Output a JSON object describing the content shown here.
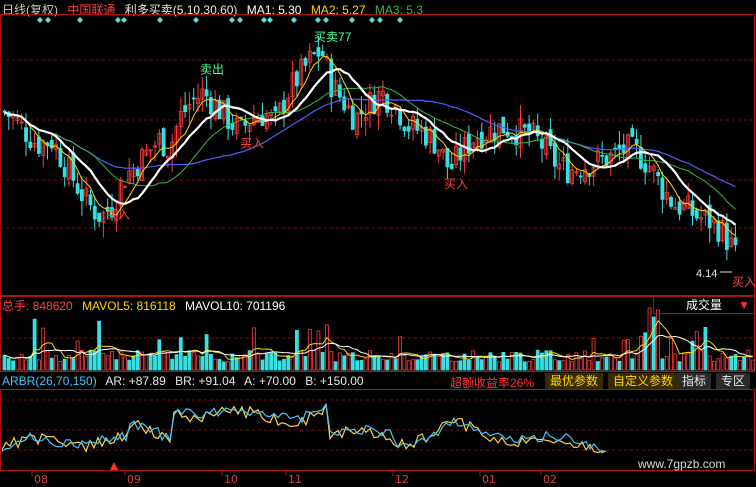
{
  "colors": {
    "bg": "#000000",
    "up": "#ff3b3b",
    "down": "#36e0e0",
    "ma1": "#ffffff",
    "ma2": "#ffd700",
    "ma3": "#3bb54a",
    "ma4": "#5060ff",
    "grid": "#7a1010",
    "border": "#b01010",
    "ar": "#40c8ff",
    "br": "#ffd24a",
    "signal": "#4dff9a"
  },
  "header": {
    "period": "日线(复权)",
    "stock_name": "中国联通",
    "indicator": "利多买卖(5,10,30,60)",
    "ma1_label": "MA1: 5.30",
    "ma2_label": "MA2: 5.27",
    "ma3_label": "MA3: 5.3"
  },
  "price_panel": {
    "signals": {
      "buy": "买入",
      "sell": "卖出",
      "buy_sell": "买卖"
    },
    "high_label": "77",
    "low_label": "4.14"
  },
  "volume_panel": {
    "total_label": "总手: 848620",
    "mavol5_label": "MAVOL5: 816118",
    "mavol10_label": "MAVOL10: 701196",
    "selector": "成交量"
  },
  "arbr_panel": {
    "name": "ARBR(26,70,150)",
    "ar_label": "AR: +87.89",
    "br_label": "BR: +91.04",
    "a_label": "A: +70.00",
    "b_label": "B: +150.00",
    "excess_return": "超额收益率26%",
    "btn_best": "最优参数",
    "btn_custom": "自定义参数",
    "btn_indicator": "指标",
    "btn_zone": "专区"
  },
  "x_axis": {
    "ticks": [
      "08",
      "09",
      "10",
      "11",
      "12",
      "01",
      "02"
    ]
  },
  "watermark": "www.7gpzb.com",
  "chart_data": [
    {
      "type": "candlestick",
      "title": "日线(复权) 中国联通",
      "series": [
        {
          "name": "MA1",
          "color": "#ffffff"
        },
        {
          "name": "MA2",
          "color": "#ffd700"
        },
        {
          "name": "MA3",
          "color": "#3bb54a"
        }
      ],
      "ma_values": {
        "MA1": 5.3,
        "MA2": 5.27,
        "MA3": 5.3
      },
      "points": [
        {
          "x": 0,
          "p": 5.95
        },
        {
          "x": 12,
          "p": 5.85
        },
        {
          "x": 24,
          "p": 5.7
        },
        {
          "x": 36,
          "p": 5.55
        },
        {
          "x": 50,
          "p": 5.6
        },
        {
          "x": 62,
          "p": 5.35
        },
        {
          "x": 74,
          "p": 5.1
        },
        {
          "x": 86,
          "p": 4.85
        },
        {
          "x": 100,
          "p": 4.7
        },
        {
          "x": 112,
          "p": 4.85
        },
        {
          "x": 122,
          "p": 5.15
        },
        {
          "x": 134,
          "p": 5.3
        },
        {
          "x": 146,
          "p": 5.45
        },
        {
          "x": 158,
          "p": 5.6
        },
        {
          "x": 168,
          "p": 5.5
        },
        {
          "x": 178,
          "p": 5.85
        },
        {
          "x": 190,
          "p": 6.05
        },
        {
          "x": 202,
          "p": 6.15
        },
        {
          "x": 214,
          "p": 6.0
        },
        {
          "x": 226,
          "p": 5.85
        },
        {
          "x": 238,
          "p": 5.7
        },
        {
          "x": 250,
          "p": 5.85
        },
        {
          "x": 262,
          "p": 5.9
        },
        {
          "x": 274,
          "p": 5.8
        },
        {
          "x": 286,
          "p": 6.15
        },
        {
          "x": 298,
          "p": 6.35
        },
        {
          "x": 310,
          "p": 6.55
        },
        {
          "x": 320,
          "p": 6.65
        },
        {
          "x": 330,
          "p": 6.25
        },
        {
          "x": 342,
          "p": 6.05
        },
        {
          "x": 354,
          "p": 5.85
        },
        {
          "x": 366,
          "p": 6.0
        },
        {
          "x": 380,
          "p": 6.15
        },
        {
          "x": 394,
          "p": 6.0
        },
        {
          "x": 408,
          "p": 5.75
        },
        {
          "x": 422,
          "p": 5.7
        },
        {
          "x": 436,
          "p": 5.55
        },
        {
          "x": 448,
          "p": 5.25
        },
        {
          "x": 460,
          "p": 5.45
        },
        {
          "x": 474,
          "p": 5.65
        },
        {
          "x": 488,
          "p": 5.7
        },
        {
          "x": 502,
          "p": 5.75
        },
        {
          "x": 516,
          "p": 5.7
        },
        {
          "x": 530,
          "p": 5.65
        },
        {
          "x": 544,
          "p": 5.5
        },
        {
          "x": 556,
          "p": 5.3
        },
        {
          "x": 568,
          "p": 5.25
        },
        {
          "x": 582,
          "p": 5.3
        },
        {
          "x": 596,
          "p": 5.35
        },
        {
          "x": 610,
          "p": 5.4
        },
        {
          "x": 624,
          "p": 5.5
        },
        {
          "x": 636,
          "p": 5.45
        },
        {
          "x": 648,
          "p": 5.3
        },
        {
          "x": 660,
          "p": 5.05
        },
        {
          "x": 672,
          "p": 4.85
        },
        {
          "x": 684,
          "p": 4.8
        },
        {
          "x": 696,
          "p": 4.7
        },
        {
          "x": 708,
          "p": 4.65
        },
        {
          "x": 720,
          "p": 4.55
        },
        {
          "x": 730,
          "p": 4.35
        },
        {
          "x": 738,
          "p": 4.14
        }
      ],
      "signals": [
        {
          "x": 118,
          "label": "买入"
        },
        {
          "x": 212,
          "label": "卖出"
        },
        {
          "x": 252,
          "label": "买入"
        },
        {
          "x": 322,
          "label": "买卖"
        },
        {
          "x": 456,
          "label": "买入"
        },
        {
          "x": 744,
          "label": "买入"
        }
      ],
      "high": 77,
      "low": 4.14
    },
    {
      "type": "bar",
      "title": "成交量",
      "series": [
        {
          "name": "MAVOL5",
          "value": 816118
        },
        {
          "name": "MAVOL10",
          "value": 701196
        }
      ],
      "latest": 848620
    },
    {
      "type": "line",
      "title": "ARBR(26,70,150)",
      "series": [
        {
          "name": "AR",
          "latest": 87.89,
          "color": "#40c8ff"
        },
        {
          "name": "BR",
          "latest": 91.04,
          "color": "#ffd24a"
        }
      ],
      "reference": {
        "A": 70.0,
        "B": 150.0
      }
    }
  ]
}
